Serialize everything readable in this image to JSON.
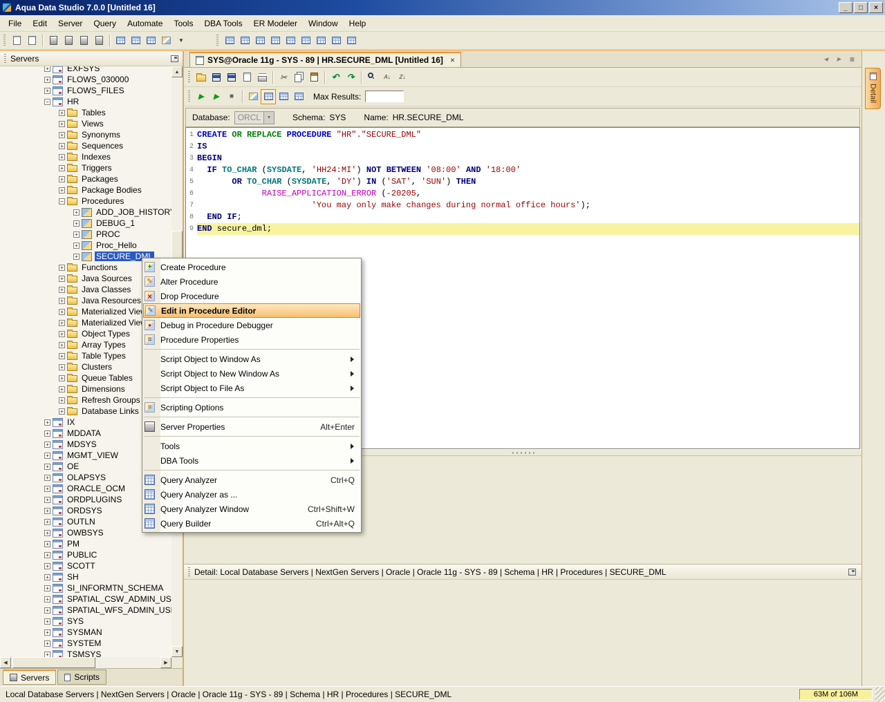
{
  "window": {
    "title": "Aqua Data Studio 7.0.0 [Untitled 16]",
    "controls": [
      {
        "name": "minimize-button",
        "glyph": "_"
      },
      {
        "name": "maximize-button",
        "glyph": "□"
      },
      {
        "name": "close-button",
        "glyph": "×"
      }
    ]
  },
  "menubar": [
    "File",
    "Edit",
    "Server",
    "Query",
    "Automate",
    "Tools",
    "DBA Tools",
    "ER Modeler",
    "Window",
    "Help"
  ],
  "main_toolbar": {
    "left": [
      {
        "name": "new-query-window-icon",
        "art": "doc"
      },
      {
        "name": "open-window-icon",
        "art": "doc"
      },
      {
        "sep": true
      },
      {
        "name": "register-server-icon",
        "art": "server"
      },
      {
        "name": "unregister-server-icon",
        "art": "server"
      },
      {
        "name": "connect-server-icon",
        "art": "server"
      },
      {
        "name": "disconnect-server-icon",
        "art": "server"
      },
      {
        "sep": true
      },
      {
        "name": "schema-browser-icon",
        "art": "grid"
      },
      {
        "name": "query-analyzer-toolbar-icon",
        "art": "grid"
      },
      {
        "name": "query-builder-toolbar-icon",
        "art": "grid"
      },
      {
        "name": "er-modeler-icon",
        "art": "diagram"
      },
      {
        "name": "tools-dropdown-arrow-icon",
        "art": "glyph-small",
        "glyph": "▼"
      }
    ],
    "right": [
      {
        "name": "window-restore-icon",
        "art": "grid"
      },
      {
        "name": "split-tab-group-icon",
        "art": "grid"
      },
      {
        "name": "tile-horizontal-icon",
        "art": "grid"
      },
      {
        "name": "tile-vertical-icon",
        "art": "grid"
      },
      {
        "name": "toggle-servers-panel-icon",
        "art": "grid"
      },
      {
        "name": "toggle-results-panel-icon",
        "art": "grid"
      },
      {
        "name": "toggle-detail-panel-icon",
        "art": "grid"
      },
      {
        "name": "full-screen-icon",
        "art": "grid"
      },
      {
        "name": "reset-windows-icon",
        "art": "grid"
      }
    ]
  },
  "servers_panel": {
    "title": "Servers",
    "tabs": [
      {
        "label": "Servers"
      },
      {
        "label": "Scripts"
      }
    ],
    "tree": [
      {
        "label": "EXFSYS",
        "lvl": 0,
        "kind": "schema"
      },
      {
        "label": "FLOWS_030000",
        "lvl": 0,
        "kind": "schema"
      },
      {
        "label": "FLOWS_FILES",
        "lvl": 0,
        "kind": "schema"
      },
      {
        "label": "HR",
        "lvl": 0,
        "kind": "schema",
        "open": true
      },
      {
        "label": "Tables",
        "lvl": 1,
        "kind": "folder"
      },
      {
        "label": "Views",
        "lvl": 1,
        "kind": "folder"
      },
      {
        "label": "Synonyms",
        "lvl": 1,
        "kind": "folder"
      },
      {
        "label": "Sequences",
        "lvl": 1,
        "kind": "folder"
      },
      {
        "label": "Indexes",
        "lvl": 1,
        "kind": "folder"
      },
      {
        "label": "Triggers",
        "lvl": 1,
        "kind": "folder"
      },
      {
        "label": "Packages",
        "lvl": 1,
        "kind": "folder"
      },
      {
        "label": "Package Bodies",
        "lvl": 1,
        "kind": "folder"
      },
      {
        "label": "Procedures",
        "lvl": 1,
        "kind": "folder",
        "open": true
      },
      {
        "label": "ADD_JOB_HISTORY",
        "lvl": 2,
        "kind": "procedure"
      },
      {
        "label": "DEBUG_1",
        "lvl": 2,
        "kind": "procedure"
      },
      {
        "label": "PROC",
        "lvl": 2,
        "kind": "procedure"
      },
      {
        "label": "Proc_Hello",
        "lvl": 2,
        "kind": "procedure"
      },
      {
        "label": "SECURE_DML",
        "lvl": 2,
        "kind": "procedure",
        "selected": true
      },
      {
        "label": "Functions",
        "lvl": 1,
        "kind": "folder"
      },
      {
        "label": "Java Sources",
        "lvl": 1,
        "kind": "folder"
      },
      {
        "label": "Java Classes",
        "lvl": 1,
        "kind": "folder"
      },
      {
        "label": "Java Resources",
        "lvl": 1,
        "kind": "folder"
      },
      {
        "label": "Materialized Views",
        "lvl": 1,
        "kind": "folder"
      },
      {
        "label": "Materialized View Logs",
        "lvl": 1,
        "kind": "folder"
      },
      {
        "label": "Object Types",
        "lvl": 1,
        "kind": "folder"
      },
      {
        "label": "Array Types",
        "lvl": 1,
        "kind": "folder"
      },
      {
        "label": "Table Types",
        "lvl": 1,
        "kind": "folder"
      },
      {
        "label": "Clusters",
        "lvl": 1,
        "kind": "folder"
      },
      {
        "label": "Queue Tables",
        "lvl": 1,
        "kind": "folder"
      },
      {
        "label": "Dimensions",
        "lvl": 1,
        "kind": "folder"
      },
      {
        "label": "Refresh Groups",
        "lvl": 1,
        "kind": "folder"
      },
      {
        "label": "Database Links",
        "lvl": 1,
        "kind": "folder"
      },
      {
        "label": "IX",
        "lvl": 0,
        "kind": "schema"
      },
      {
        "label": "MDD A TA",
        "lvl": 0,
        "kind": "schema",
        "fix": "MDDATA"
      },
      {
        "label": "MDSYS",
        "lvl": 0,
        "kind": "schema"
      },
      {
        "label": "MGMT_VIEW",
        "lvl": 0,
        "kind": "schema"
      },
      {
        "label": "OE",
        "lvl": 0,
        "kind": "schema"
      },
      {
        "label": "OLAPSYS",
        "lvl": 0,
        "kind": "schema"
      },
      {
        "label": "ORACLE_OCM",
        "lvl": 0,
        "kind": "schema"
      },
      {
        "label": "ORDPLUGINS",
        "lvl": 0,
        "kind": "schema"
      },
      {
        "label": "ORDSYS",
        "lvl": 0,
        "kind": "schema"
      },
      {
        "label": "OUTLN",
        "lvl": 0,
        "kind": "schema"
      },
      {
        "label": "OWBSYS",
        "lvl": 0,
        "kind": "schema"
      },
      {
        "label": "PM",
        "lvl": 0,
        "kind": "schema"
      },
      {
        "label": "PUBLIC",
        "lvl": 0,
        "kind": "schema"
      },
      {
        "label": "SCOTT",
        "lvl": 0,
        "kind": "schema"
      },
      {
        "label": "SH",
        "lvl": 0,
        "kind": "schema"
      },
      {
        "label": "SI_INFORMTN_SCHEMA",
        "lvl": 0,
        "kind": "schema"
      },
      {
        "label": "SPATIAL_CSW_ADMIN_USR",
        "lvl": 0,
        "kind": "schema"
      },
      {
        "label": "SPATIAL_WFS_ADMIN_USR",
        "lvl": 0,
        "kind": "schema"
      },
      {
        "label": "SYS",
        "lvl": 0,
        "kind": "schema"
      },
      {
        "label": "SYSMAN",
        "lvl": 0,
        "kind": "schema"
      },
      {
        "label": "SYSTEM",
        "lvl": 0,
        "kind": "schema"
      },
      {
        "label": "TSMSYS",
        "lvl": 0,
        "kind": "schema"
      }
    ]
  },
  "document_tab": {
    "title": "SYS@Oracle 11g - SYS - 89 | HR.SECURE_DML [Untitled 16]",
    "close_glyph": "×"
  },
  "tab_nav": [
    {
      "name": "scroll-tabs-left-icon",
      "art": "glyph-small",
      "glyph": "◀"
    },
    {
      "name": "scroll-tabs-right-icon",
      "art": "glyph-small",
      "glyph": "▶"
    },
    {
      "name": "tab-list-icon",
      "art": "glyph",
      "glyph": "≡"
    }
  ],
  "editor_toolbar_file": [
    {
      "name": "open-file-icon",
      "art": "folder"
    },
    {
      "name": "save-file-icon",
      "art": "disk"
    },
    {
      "name": "save-all-icon",
      "art": "disk"
    },
    {
      "name": "export-file-icon",
      "art": "doc"
    },
    {
      "name": "print-icon",
      "art": "printer"
    },
    {
      "sep": true
    },
    {
      "name": "cut-icon",
      "art": "glyph",
      "glyph": "✂"
    },
    {
      "name": "copy-icon",
      "art": "copy"
    },
    {
      "name": "paste-icon",
      "art": "paste"
    },
    {
      "sep": true
    },
    {
      "name": "undo-icon",
      "art": "glyph-green",
      "glyph": "↶"
    },
    {
      "name": "redo-icon",
      "art": "glyph-green",
      "glyph": "↷"
    },
    {
      "sep": true
    },
    {
      "name": "find-icon",
      "art": "find"
    },
    {
      "name": "sort-ascending-icon",
      "art": "glyph-small",
      "glyph": "A↓"
    },
    {
      "name": "sort-descending-icon",
      "art": "glyph-small",
      "glyph": "Z↓"
    }
  ],
  "editor_toolbar_exec": [
    {
      "name": "execute-query-icon",
      "art": "glyph-play",
      "glyph": "▶"
    },
    {
      "name": "execute-edit-icon",
      "art": "glyph-play",
      "glyph": "▶"
    },
    {
      "name": "stop-execution-icon",
      "art": "glyph-stop",
      "glyph": "■"
    },
    {
      "sep": true
    },
    {
      "name": "explain-plan-icon",
      "art": "diagram"
    },
    {
      "name": "grid-results-icon",
      "art": "grid",
      "active": true
    },
    {
      "name": "text-results-icon",
      "art": "grid"
    },
    {
      "name": "export-results-icon",
      "art": "grid"
    }
  ],
  "query_bar": {
    "max_results_label": "Max Results:",
    "max_results_value": ""
  },
  "info_bar": {
    "database_label": "Database:",
    "database_value": "ORCL",
    "schema_label": "Schema:",
    "schema_value": "SYS",
    "name_label": "Name:",
    "name_value": "HR.SECURE_DML"
  },
  "editor": {
    "highlight_line": 9,
    "code_lines": [
      [
        {
          "t": "CREATE",
          "c": "b"
        },
        {
          "t": " "
        },
        {
          "t": "OR",
          "c": "g"
        },
        {
          "t": " "
        },
        {
          "t": "REPLACE",
          "c": "g"
        },
        {
          "t": " "
        },
        {
          "t": "PROCEDURE",
          "c": "b"
        },
        {
          "t": " "
        },
        {
          "t": "\"HR\".\"SECURE_DML\"",
          "c": "s"
        }
      ],
      [
        {
          "t": "IS",
          "c": "k"
        }
      ],
      [
        {
          "t": "BEGIN",
          "c": "k"
        }
      ],
      [
        {
          "t": "  "
        },
        {
          "t": "IF",
          "c": "k"
        },
        {
          "t": " "
        },
        {
          "t": "TO_CHAR",
          "c": "f"
        },
        {
          "t": " ("
        },
        {
          "t": "SYSDATE",
          "c": "f"
        },
        {
          "t": ", "
        },
        {
          "t": "'HH24:MI'",
          "c": "s"
        },
        {
          "t": ") "
        },
        {
          "t": "NOT BETWEEN",
          "c": "k"
        },
        {
          "t": " "
        },
        {
          "t": "'08:00'",
          "c": "s"
        },
        {
          "t": " "
        },
        {
          "t": "AND",
          "c": "k"
        },
        {
          "t": " "
        },
        {
          "t": "'18:00'",
          "c": "s"
        }
      ],
      [
        {
          "t": "       "
        },
        {
          "t": "OR",
          "c": "k"
        },
        {
          "t": " "
        },
        {
          "t": "TO_CHAR",
          "c": "f"
        },
        {
          "t": " ("
        },
        {
          "t": "SYSDATE",
          "c": "f"
        },
        {
          "t": ", "
        },
        {
          "t": "'DY'",
          "c": "s"
        },
        {
          "t": ") "
        },
        {
          "t": "IN",
          "c": "k"
        },
        {
          "t": " ("
        },
        {
          "t": "'SAT'",
          "c": "s"
        },
        {
          "t": ", "
        },
        {
          "t": "'SUN'",
          "c": "s"
        },
        {
          "t": ") "
        },
        {
          "t": "THEN",
          "c": "k"
        }
      ],
      [
        {
          "t": "             "
        },
        {
          "t": "RAISE_APPLICATION_ERROR",
          "c": "m"
        },
        {
          "t": " ("
        },
        {
          "t": "-20205",
          "c": "n"
        },
        {
          "t": ","
        }
      ],
      [
        {
          "t": "                       "
        },
        {
          "t": "'You may only make changes during normal office hours'",
          "c": "s"
        },
        {
          "t": ");"
        }
      ],
      [
        {
          "t": "  "
        },
        {
          "t": "END IF",
          "c": "k"
        },
        {
          "t": ";"
        }
      ],
      [
        {
          "t": "END",
          "c": "k"
        },
        {
          "t": " secure_dml;"
        }
      ]
    ]
  },
  "context_menu": {
    "items": [
      {
        "label": "Create Procedure",
        "icon": "create-procedure-icon"
      },
      {
        "label": "Alter Procedure",
        "icon": "alter-procedure-icon"
      },
      {
        "label": "Drop Procedure",
        "icon": "drop-procedure-icon"
      },
      {
        "label": "Edit in Procedure Editor",
        "icon": "edit-in-procedure-editor-icon",
        "highlighted": true
      },
      {
        "label": "Debug in Procedure Debugger",
        "icon": "debug-procedure-icon"
      },
      {
        "label": "Procedure Properties",
        "icon": "procedure-properties-icon"
      },
      {
        "separator": true
      },
      {
        "label": "Script Object to Window As",
        "submenu": true
      },
      {
        "label": "Script Object to New Window As",
        "submenu": true
      },
      {
        "label": "Script Object to File As",
        "submenu": true
      },
      {
        "separator": true
      },
      {
        "label": "Scripting Options",
        "icon": "scripting-options-icon"
      },
      {
        "separator": true
      },
      {
        "label": "Server Properties",
        "icon": "server-properties-icon",
        "shortcut": "Alt+Enter"
      },
      {
        "separator": true
      },
      {
        "label": "Tools",
        "submenu": true
      },
      {
        "label": "DBA Tools",
        "submenu": true
      },
      {
        "separator": true
      },
      {
        "label": "Query Analyzer",
        "icon": "query-analyzer-icon",
        "shortcut": "Ctrl+Q"
      },
      {
        "label": "Query Analyzer as ...",
        "icon": "query-analyzer-as-icon"
      },
      {
        "label": "Query Analyzer Window",
        "icon": "query-analyzer-window-icon",
        "shortcut": "Ctrl+Shift+W"
      },
      {
        "label": "Query Builder",
        "icon": "query-builder-icon",
        "shortcut": "Ctrl+Alt+Q"
      }
    ]
  },
  "detail_panel": {
    "title": "Detail: Local Database Servers | NextGen Servers | Oracle | Oracle 11g - SYS - 89 | Schema | HR | Procedures | SECURE_DML"
  },
  "detail_side_tab": {
    "label": "Detail"
  },
  "status_bar": {
    "path": "Local Database Servers | NextGen Servers | Oracle | Oracle 11g - SYS - 89 | Schema | HR | Procedures | SECURE_DML",
    "memory": "63M of 106M"
  }
}
